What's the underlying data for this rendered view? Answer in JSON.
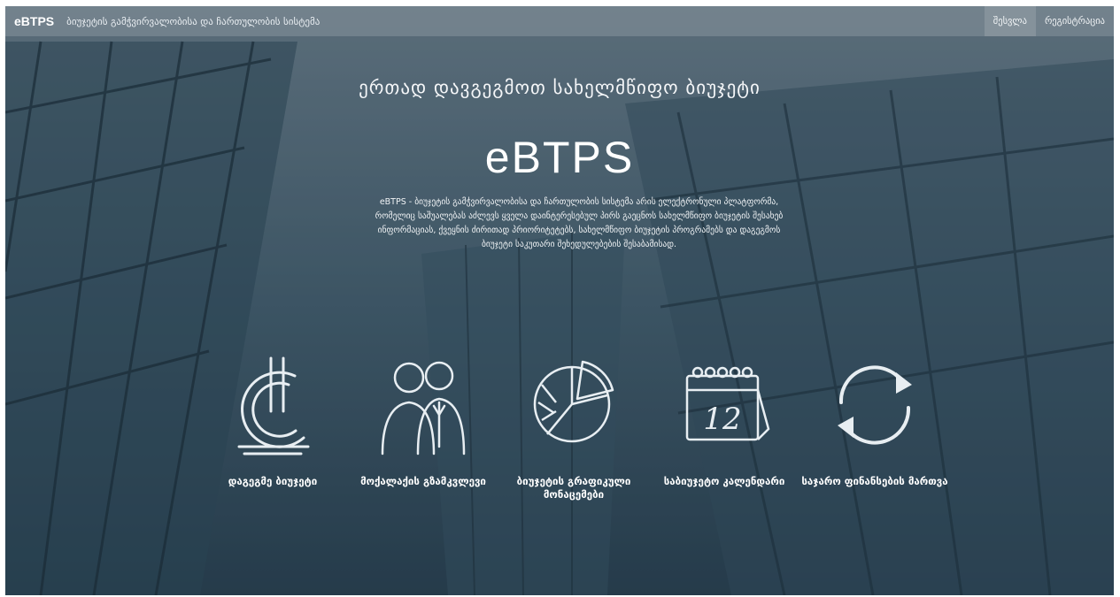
{
  "navbar": {
    "brand": "eBTPS",
    "subtitle": "ბიუჯეტის გამჭვირვალობისა და ჩართულობის სისტემა",
    "login": "შესვლა",
    "register": "რეგისტრაცია"
  },
  "hero": {
    "tagline": "ერთად დავგეგმოთ სახელმწიფო ბიუჯეტი",
    "title": "eBTPS",
    "description": "eBTPS - ბიუჯეტის გამჭვირვალობისა და ჩართულობის სისტემა არის ელექტრონული პლატფორმა, რომელიც საშუალებას აძლევს ყველა დაინტერესებულ პირს გაეცნოს სახელმწიფო ბიუჯეტის შესახებ ინფორმაციას, ქვეყნის ძირითად პრიორიტეტებს, სახელმწიფო ბიუჯეტის პროგრამებს და დაგეგმოს ბიუჯეტი საკუთარი შეხედულებების შესაბამისად."
  },
  "features": [
    {
      "label": "დაგეგმე ბიუჯეტი",
      "icon": "lari-currency-icon"
    },
    {
      "label": "მოქალაქის გზამკვლევი",
      "icon": "people-icon"
    },
    {
      "label": "ბიუჯეტის გრაფიკული მონაცემები",
      "icon": "pie-chart-icon"
    },
    {
      "label": "საბიუჯეტო კალენდარი",
      "icon": "calendar-icon"
    },
    {
      "label": "საჯარო ფინანსების მართვა",
      "icon": "refresh-cycle-icon"
    }
  ],
  "calendar_day": "12"
}
